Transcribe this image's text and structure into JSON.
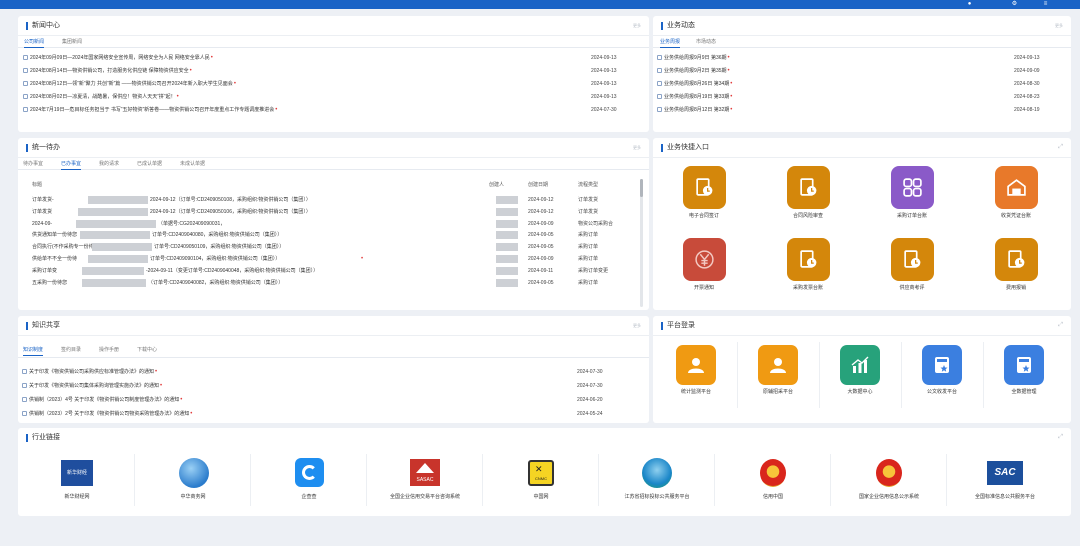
{
  "news": {
    "title": "新闻中心",
    "more": "更多",
    "tabs": [
      "公司新闻",
      "集团新闻"
    ],
    "rows": [
      {
        "text": "2024年09月09日—2024年国家网络安全宣传周，网络安全为人民 网络安全靠人民",
        "date": "2024-09-13"
      },
      {
        "text": "2024年08月14日—物资供销公司，打造服务化供应链 保障物资供应安全",
        "date": "2024-09-13"
      },
      {
        "text": "2024年08月12日—领“新”聚力 共创“新”篇 ——物资供销公司召开2024年新入职大学生见面会",
        "date": "2024-09-13"
      },
      {
        "text": "2024年08月02日—凉夏清，战酷暑，保供应！物资人天天“拼”起！",
        "date": "2024-09-13"
      },
      {
        "text": "2024年7月19日—危目标任务担当于 书写“五好物资”新答卷——物资供销公司召开年度重点工作专题调度推进会",
        "date": "2024-07-30"
      }
    ]
  },
  "biz": {
    "title": "业务动态",
    "more": "更多",
    "tabs": [
      "业务周报",
      "市场动态"
    ],
    "rows": [
      {
        "text": "业务供给周报9月9日 第36期",
        "date": "2024-09-13"
      },
      {
        "text": "业务供给周报9月2日 第35期",
        "date": "2024-09-09"
      },
      {
        "text": "业务供给周报8月26日 第34期",
        "date": "2024-08-30"
      },
      {
        "text": "业务供给周报8月19日 第33期",
        "date": "2024-08-23"
      },
      {
        "text": "业务供给周报8月12日 第32期",
        "date": "2024-08-19"
      }
    ]
  },
  "todo": {
    "title": "统一待办",
    "more": "更多",
    "tabs": [
      "待办事宜",
      "已办事宜",
      "我的请求",
      "已成认单据",
      "未成认单据"
    ],
    "headers": [
      "标题",
      "创建人",
      "创建日期",
      "流程类型"
    ],
    "rows": [
      {
        "title_a": "订单发货-",
        "title_b": "2024-09-12（订单号:CD2409050108，采购组织:物资供销公司（集团））",
        "date": "2024-09-12",
        "type": "订单发货"
      },
      {
        "title_a": "订单发货",
        "title_b": "2024-09-12（订单号:CD2409050106，采购组织:物资供销公司（集团））",
        "date": "2024-09-12",
        "type": "订单发货"
      },
      {
        "title_a": "2024-09-",
        "title_b": "（单据号:CG202409090031，",
        "date": "2024-09-09",
        "type": "物资公司采购合"
      },
      {
        "title_a": "供货通知单一份待您",
        "title_b": "订单号:CD2409040080，采购组织:物资供销公司（集团））",
        "date": "2024-09-05",
        "type": "采购订单"
      },
      {
        "title_a": "合同执行(不作采购专一份待您",
        "title_b": "订单号:CD2409050109，采购组织:物资供销公司（集团））",
        "date": "2024-09-05",
        "type": "采购订单"
      },
      {
        "title_a": "供给单不不全一份待",
        "title_b": "订单号:CD2409090104，采购组织:物资供销公司（集团））",
        "date": "2024-09-09",
        "type": "采购订单"
      },
      {
        "title_a": "采购订单变",
        "title_b": "-2024-09-11（变更订单号:CD2409040048，采购组织:物资供销公司（集团））",
        "date": "2024-09-11",
        "type": "采购订单变更"
      },
      {
        "title_a": "五采购一份待您",
        "title_b": "（订单号:CD2409040082，采购组织:物资供销公司（集团））",
        "date": "2024-09-05",
        "type": "采购订单"
      }
    ]
  },
  "quick": {
    "title": "业务快捷入口",
    "items": [
      {
        "label": "电子合同签订",
        "icon": "contract-clock-icon",
        "color": "#d4870b"
      },
      {
        "label": "合同风险审查",
        "icon": "risk-review-icon",
        "color": "#d4870b"
      },
      {
        "label": "采购订单台账",
        "icon": "grid-apps-icon",
        "color": "#8a5ac8"
      },
      {
        "label": "收货凭证台账",
        "icon": "warehouse-icon",
        "color": "#e8792a"
      },
      {
        "label": "开票通知",
        "icon": "yen-icon",
        "color": "#c84b3a"
      },
      {
        "label": "采购发票台账",
        "icon": "invoice-clock-icon",
        "color": "#d4870b"
      },
      {
        "label": "供应商考评",
        "icon": "evaluate-clock-icon",
        "color": "#d4870b"
      },
      {
        "label": "费用报销",
        "icon": "expense-clock-icon",
        "color": "#d4870b"
      }
    ]
  },
  "platform": {
    "title": "平台登录",
    "items": [
      {
        "label": "统计监测平台",
        "icon": "user-card-icon",
        "color": "#f09a12"
      },
      {
        "label": "原辅招采平台",
        "icon": "user-card-icon",
        "color": "#f09a12"
      },
      {
        "label": "大数据中心",
        "icon": "bar-chart-icon",
        "color": "#27a27b"
      },
      {
        "label": "公文收发平台",
        "icon": "doc-star-icon",
        "color": "#3b7fe0"
      },
      {
        "label": "全数据管理",
        "icon": "doc-star-icon",
        "color": "#3b7fe0"
      }
    ]
  },
  "knowledge": {
    "title": "知识共享",
    "more": "更多",
    "tabs": [
      "知识制度",
      "签约目录",
      "操作手册",
      "下载中心"
    ],
    "rows": [
      {
        "text": "关于印发《物资供销公司采购供应标准管理办法》的通知",
        "date": "2024-07-30"
      },
      {
        "text": "关于印发《物资供销公司集体采购询管理实施办法》的通知",
        "date": "2024-07-30"
      },
      {
        "text": "供销制（2023）4号 关于印发《物资供销公司制度管理办法》的通知",
        "date": "2024-06-20"
      },
      {
        "text": "供销制（2023）2号 关于印发《物资供销公司物资采购管理办法》的通知",
        "date": "2024-05-24"
      }
    ]
  },
  "links": {
    "title": "行业链接",
    "items": [
      {
        "label": "新华财经网",
        "icon": "xinhua-logo"
      },
      {
        "label": "中华商务网",
        "icon": "globe-logo"
      },
      {
        "label": "企查查",
        "icon": "qcc-logo"
      },
      {
        "label": "全国企业信用交易平台咨询系统",
        "icon": "sasac-logo"
      },
      {
        "label": "中国网",
        "icon": "cnmc-logo"
      },
      {
        "label": "江苏省招标投标公共服务平台",
        "icon": "jiangsu-logo"
      },
      {
        "label": "信用中国",
        "icon": "national-emblem-logo"
      },
      {
        "label": "国家企业信用信息公示系统",
        "icon": "national-emblem-logo"
      },
      {
        "label": "全国标准信息公共服务平台",
        "icon": "sac-logo"
      }
    ],
    "logo_text": {
      "xinhua": "新华财经",
      "sasac": "SASAC",
      "cnmc": "CNMC",
      "sac": "SAC"
    }
  }
}
